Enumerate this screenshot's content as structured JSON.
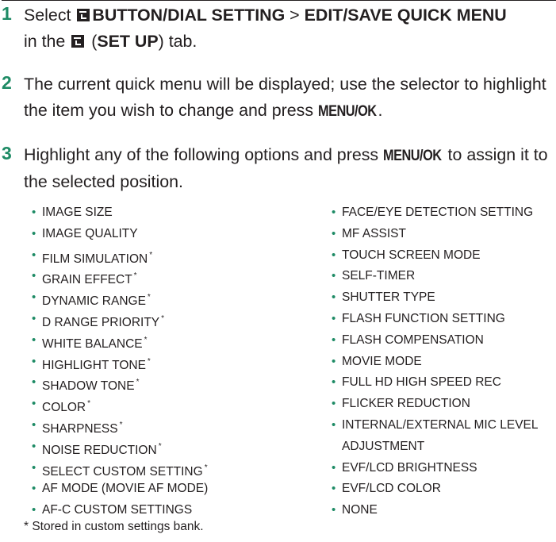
{
  "steps": [
    {
      "number": "1",
      "parts": {
        "a": "Select",
        "b": "BUTTON/DIAL SETTING",
        "c": " > ",
        "d": "EDIT/SAVE QUICK MENU",
        "e": "in the",
        "f": "(",
        "g": "SET UP",
        "h": ") tab."
      },
      "icon": "setup-tab-icon"
    },
    {
      "number": "2",
      "text_before": "The current quick menu will be displayed; use the selector to highlight the item you wish to change and press ",
      "keyword": "MENU/OK",
      "text_after": "."
    },
    {
      "number": "3",
      "text_before": "Highlight any of the following options and press ",
      "keyword": "MENU/OK",
      "text_after": " to assign it to the selected position."
    }
  ],
  "options_left": [
    {
      "label": "IMAGE SIZE",
      "mark": ""
    },
    {
      "label": "IMAGE QUALITY",
      "mark": ""
    },
    {
      "label": "FILM SIMULATION",
      "mark": "*"
    },
    {
      "label": "GRAIN EFFECT",
      "mark": "*"
    },
    {
      "label": "DYNAMIC RANGE",
      "mark": "*"
    },
    {
      "label": "D RANGE PRIORITY",
      "mark": "*"
    },
    {
      "label": "WHITE BALANCE",
      "mark": "*"
    },
    {
      "label": "HIGHLIGHT TONE",
      "mark": "*"
    },
    {
      "label": "SHADOW TONE",
      "mark": "*"
    },
    {
      "label": "COLOR",
      "mark": "*"
    },
    {
      "label": "SHARPNESS",
      "mark": "*"
    },
    {
      "label": "NOISE REDUCTION",
      "mark": "*"
    },
    {
      "label": "SELECT CUSTOM SETTING",
      "mark": "*"
    },
    {
      "label": "AF MODE (MOVIE AF MODE)",
      "mark": ""
    },
    {
      "label": "AF-C CUSTOM SETTINGS",
      "mark": ""
    }
  ],
  "options_right": [
    {
      "label": "FACE/EYE DETECTION SETTING",
      "mark": ""
    },
    {
      "label": "MF ASSIST",
      "mark": ""
    },
    {
      "label": "TOUCH SCREEN MODE",
      "mark": ""
    },
    {
      "label": "SELF-TIMER",
      "mark": ""
    },
    {
      "label": "SHUTTER TYPE",
      "mark": ""
    },
    {
      "label": "FLASH FUNCTION SETTING",
      "mark": ""
    },
    {
      "label": "FLASH COMPENSATION",
      "mark": ""
    },
    {
      "label": "MOVIE MODE",
      "mark": ""
    },
    {
      "label": "FULL HD HIGH SPEED REC",
      "mark": ""
    },
    {
      "label": "FLICKER REDUCTION",
      "mark": ""
    },
    {
      "label": "INTERNAL/EXTERNAL MIC LEVEL ADJUSTMENT",
      "mark": ""
    },
    {
      "label": "EVF/LCD BRIGHTNESS",
      "mark": ""
    },
    {
      "label": "EVF/LCD COLOR",
      "mark": ""
    },
    {
      "label": "NONE",
      "mark": ""
    }
  ],
  "footnote": "* Stored in custom settings bank.",
  "colors": {
    "accent": "#1e8b65",
    "text": "#231f20"
  }
}
